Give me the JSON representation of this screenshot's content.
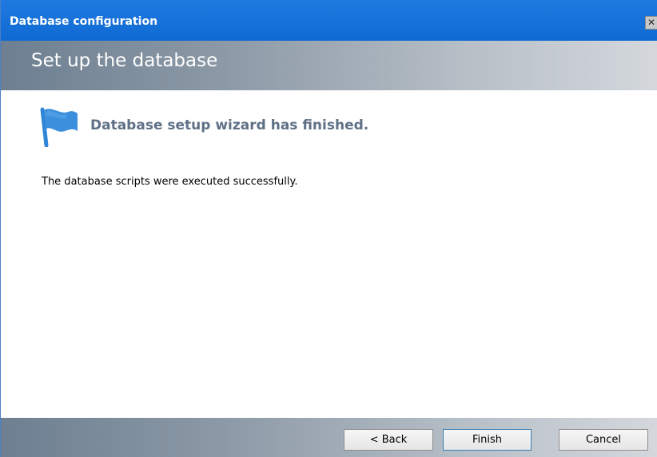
{
  "window": {
    "title": "Database configuration",
    "close_glyph": "✕"
  },
  "header": {
    "heading": "Set up the database"
  },
  "content": {
    "icon": "flag-icon",
    "finished_heading": "Database setup wizard has finished.",
    "result_text": "The database scripts were executed successfully."
  },
  "footer": {
    "back_label": "< Back",
    "finish_label": "Finish",
    "cancel_label": "Cancel"
  },
  "colors": {
    "titlebar": "#1f7ae0",
    "flag": "#2f86d6",
    "heading_text": "#5f7086"
  }
}
